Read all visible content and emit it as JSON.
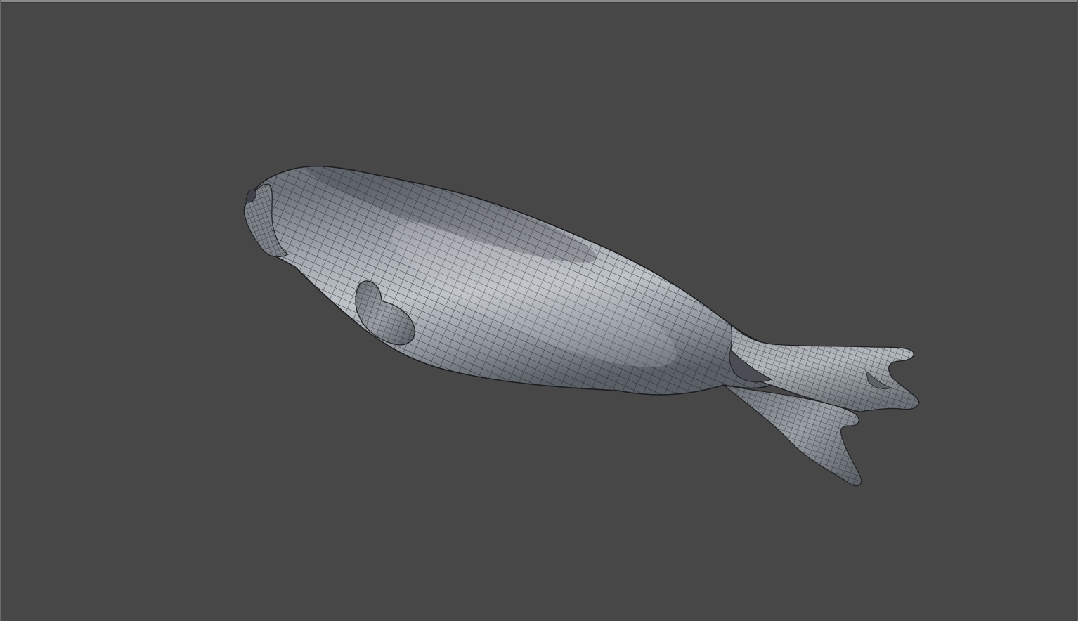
{
  "viewport": {
    "background_color": "#474747",
    "frame_color": "#8a8a8a",
    "shading_mode": "smooth-shaded-with-wireframe"
  },
  "model": {
    "icon": "seal-mesh-icon",
    "surface_color_light": "#b7bcc2",
    "surface_color_mid": "#8d939a",
    "surface_color_dark": "#4f545a",
    "wire_color": "#1e2024"
  }
}
